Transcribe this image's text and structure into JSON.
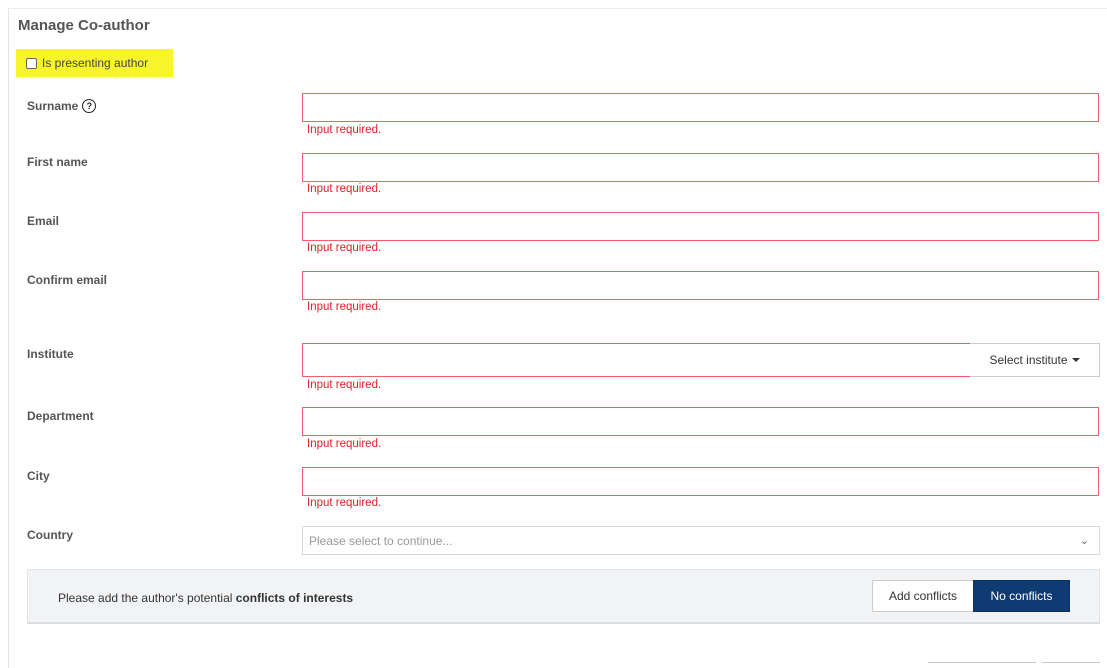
{
  "title": "Manage Co-author",
  "presenting_label": "Is presenting author",
  "fields": {
    "surname": {
      "label": "Surname",
      "help_icon": "?",
      "value": "",
      "error": "Input required."
    },
    "first_name": {
      "label": "First name",
      "value": "",
      "error": "Input required."
    },
    "email": {
      "label": "Email",
      "value": "",
      "error": "Input required."
    },
    "confirm_email": {
      "label": "Confirm email",
      "value": "",
      "error": "Input required."
    },
    "institute": {
      "label": "Institute",
      "value": "",
      "error": "Input required.",
      "select_button": "Select institute"
    },
    "department": {
      "label": "Department",
      "value": "",
      "error": "Input required."
    },
    "city": {
      "label": "City",
      "value": "",
      "error": "Input required."
    },
    "country": {
      "label": "Country",
      "placeholder": "Please select to continue..."
    }
  },
  "conflicts": {
    "text": "Please add the author's potential ",
    "text_bold": "conflicts of interests",
    "add_button": "Add conflicts",
    "no_button": "No conflicts"
  },
  "colors": {
    "error": "#e0202a",
    "primary": "#103a72",
    "highlight": "#f7f52a"
  }
}
